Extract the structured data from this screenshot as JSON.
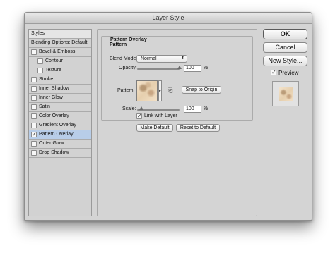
{
  "window": {
    "title": "Layer Style"
  },
  "styles_list": {
    "header": "Styles",
    "items": [
      {
        "label": "Blending Options: Default",
        "checkbox": false,
        "checked": false,
        "indent": 0,
        "selected": false
      },
      {
        "label": "Bevel & Emboss",
        "checkbox": true,
        "checked": false,
        "indent": 0,
        "selected": false
      },
      {
        "label": "Contour",
        "checkbox": true,
        "checked": false,
        "indent": 1,
        "selected": false
      },
      {
        "label": "Texture",
        "checkbox": true,
        "checked": false,
        "indent": 1,
        "selected": false
      },
      {
        "label": "Stroke",
        "checkbox": true,
        "checked": false,
        "indent": 0,
        "selected": false
      },
      {
        "label": "Inner Shadow",
        "checkbox": true,
        "checked": false,
        "indent": 0,
        "selected": false
      },
      {
        "label": "Inner Glow",
        "checkbox": true,
        "checked": false,
        "indent": 0,
        "selected": false
      },
      {
        "label": "Satin",
        "checkbox": true,
        "checked": false,
        "indent": 0,
        "selected": false
      },
      {
        "label": "Color Overlay",
        "checkbox": true,
        "checked": false,
        "indent": 0,
        "selected": false
      },
      {
        "label": "Gradient Overlay",
        "checkbox": true,
        "checked": false,
        "indent": 0,
        "selected": false
      },
      {
        "label": "Pattern Overlay",
        "checkbox": true,
        "checked": true,
        "indent": 0,
        "selected": true
      },
      {
        "label": "Outer Glow",
        "checkbox": true,
        "checked": false,
        "indent": 0,
        "selected": false
      },
      {
        "label": "Drop Shadow",
        "checkbox": true,
        "checked": false,
        "indent": 0,
        "selected": false
      }
    ]
  },
  "pattern_overlay": {
    "section_title": "Pattern Overlay",
    "section_subtitle": "Pattern",
    "blend_mode_label": "Blend Mode:",
    "blend_mode_value": "Normal",
    "opacity_label": "Opacity:",
    "opacity_value": "100",
    "opacity_fraction": 1.0,
    "percent_sign": "%",
    "pattern_label": "Pattern:",
    "snap_button": "Snap to Origin",
    "scale_label": "Scale:",
    "scale_value": "100",
    "scale_fraction": 0.1,
    "link_label": "Link with Layer",
    "link_checked": true,
    "make_default_button": "Make Default",
    "reset_default_button": "Reset to Default"
  },
  "actions": {
    "ok": "OK",
    "cancel": "Cancel",
    "new_style": "New Style...",
    "preview_label": "Preview",
    "preview_checked": true
  },
  "check_mark": "✓",
  "dropdown_arrow": "⬍",
  "icons": {
    "pattern-dropdown": "▸",
    "new-preset": "⎗"
  }
}
